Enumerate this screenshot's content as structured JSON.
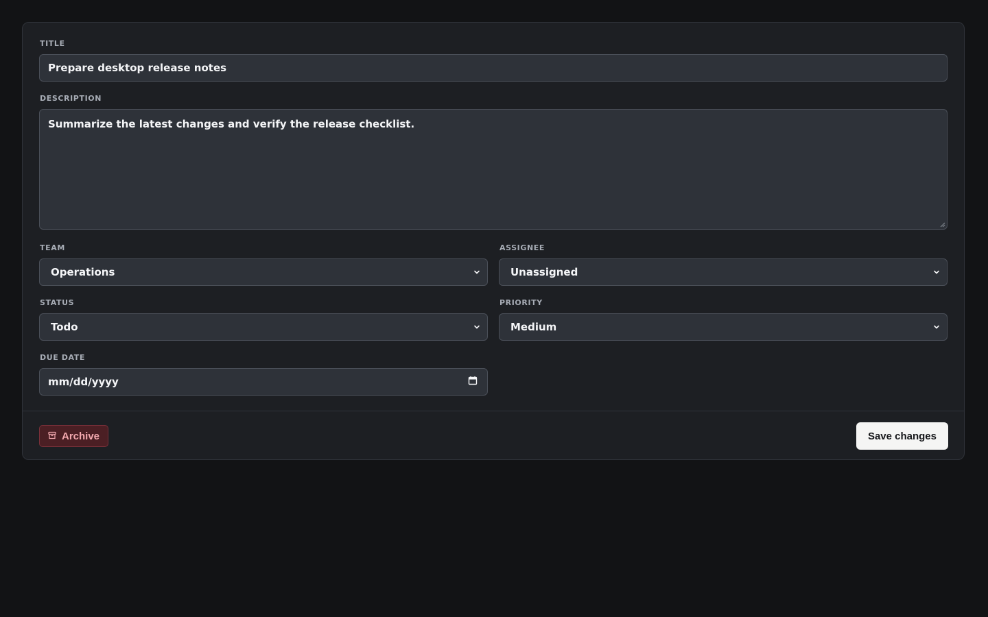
{
  "form": {
    "title": {
      "label": "TITLE",
      "value": "Prepare desktop release notes"
    },
    "description": {
      "label": "DESCRIPTION",
      "value": "Summarize the latest changes and verify the release checklist."
    },
    "team": {
      "label": "TEAM",
      "value": "Operations"
    },
    "assignee": {
      "label": "ASSIGNEE",
      "value": "Unassigned"
    },
    "status": {
      "label": "STATUS",
      "value": "Todo"
    },
    "priority": {
      "label": "PRIORITY",
      "value": "Medium"
    },
    "due_date": {
      "label": "DUE DATE",
      "placeholder": "mm/dd/yyyy"
    }
  },
  "footer": {
    "archive_label": "Archive",
    "save_label": "Save changes"
  },
  "icons": {
    "archive": "archive-icon",
    "calendar": "calendar-icon",
    "chevron": "chevron-down-icon"
  },
  "colors": {
    "page_bg": "#121315",
    "card_bg": "#1d1f23",
    "field_bg": "#2e3239",
    "archive_text": "#f3a9af",
    "archive_bg": "#4b1f24",
    "save_bg": "#f5f5f4"
  }
}
